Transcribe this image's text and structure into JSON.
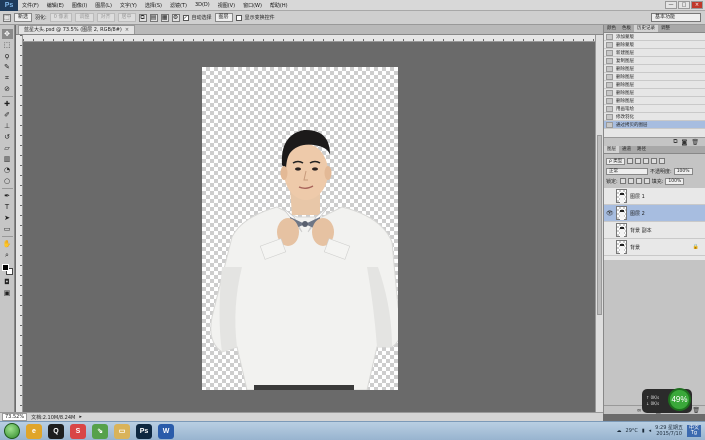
{
  "menubar": {
    "logo": "Ps",
    "items": [
      "文件(F)",
      "编辑(E)",
      "图像(I)",
      "图层(L)",
      "文字(Y)",
      "选择(S)",
      "滤镜(T)",
      "3D(D)",
      "视图(V)",
      "窗口(W)",
      "帮助(H)"
    ],
    "controls": [
      "—",
      "□",
      "×"
    ]
  },
  "optionsbar": {
    "mode": "新选",
    "feather_label": "羽化:",
    "feather_value": "0 像素",
    "btn1": "调整",
    "btn2": "对齐",
    "btn3": "居中",
    "auto_select_label": "自动选择",
    "auto_select_value": "图层",
    "show_transform_label": "显示变换控件",
    "workspace": "基本功能"
  },
  "document": {
    "tab_title": "蓝星大头.psd @ 73.5% (图层 2, RGB/8#)",
    "zoom": "73.52%",
    "doc_info": "文档:2.10M/8.24M"
  },
  "history_panel": {
    "tabs": [
      "颜色",
      "色板",
      "历史记录",
      "调整"
    ],
    "items": [
      "添加蒙版",
      "删除蒙版",
      "新建图层",
      "复制图层",
      "删除图层",
      "删除图层",
      "删除图层",
      "删除图层",
      "删除图层",
      "用画笔绘",
      "修改羽化",
      "通过拷贝的图层"
    ]
  },
  "layers_panel": {
    "tabs": [
      "图层",
      "通道",
      "路径"
    ],
    "filter_label": "ρ 类型",
    "blend_mode": "正常",
    "opacity_label": "不透明度:",
    "opacity_value": "100%",
    "lock_label": "锁定:",
    "fill_label": "填充:",
    "fill_value": "100%",
    "layers": [
      {
        "name": "图层 1",
        "eye": ""
      },
      {
        "name": "图层 2",
        "eye": "👁"
      },
      {
        "name": "背景 副本",
        "eye": ""
      },
      {
        "name": "背景",
        "eye": "",
        "lock": "🔒"
      }
    ]
  },
  "widget": {
    "up_speed": "0K/s",
    "down_speed": "0K/s",
    "cpu": "49%"
  },
  "taskbar": {
    "temperature": "29°C",
    "time": "9:29 星期五",
    "date": "2015/7/10",
    "ime_top": "中文",
    "ime_bottom": "Tg"
  },
  "colors": {
    "foreground": "#000000",
    "background": "#ffffff",
    "selection": "#a7bde0"
  }
}
